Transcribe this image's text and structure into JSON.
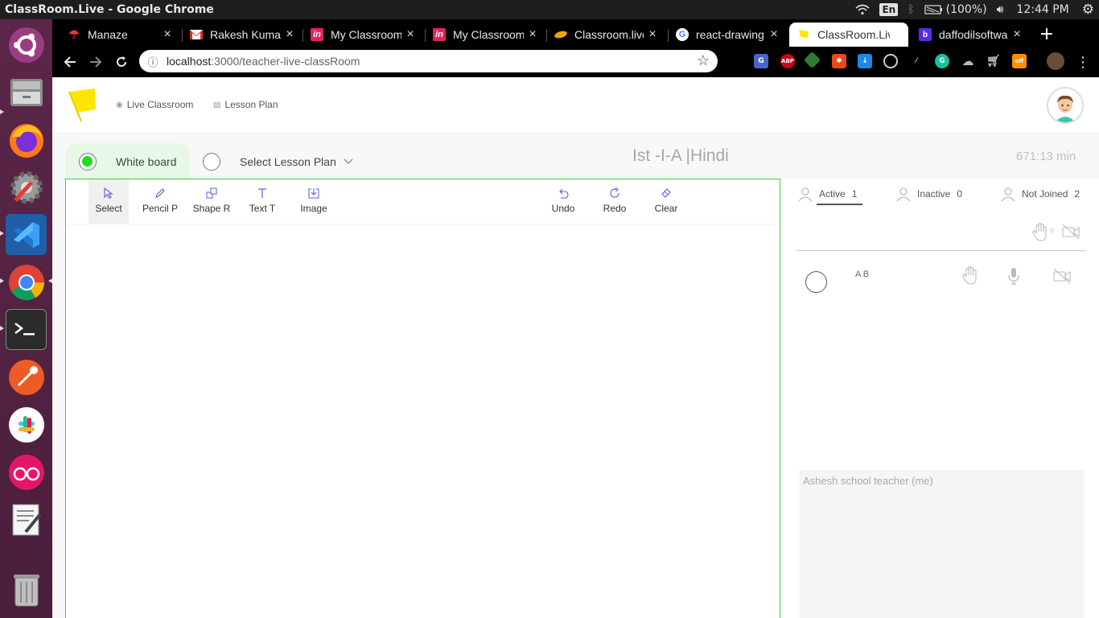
{
  "window": {
    "title": "ClassRoom.Live - Google Chrome"
  },
  "tray": {
    "lang": "En",
    "battery": "(100%)",
    "time": "12:44 PM"
  },
  "dock": {
    "items": [
      "ubuntu-icon",
      "files-icon",
      "firefox-icon",
      "settings-icon",
      "vscode-icon",
      "chrome-icon",
      "terminal-icon",
      "postman-icon",
      "slack-icon",
      "flickr-icon",
      "text-editor-icon",
      "trash-icon"
    ]
  },
  "tabs": [
    {
      "label": "Manaze",
      "color": "#e53935"
    },
    {
      "label": "Rakesh Kumar",
      "color": "#d93025"
    },
    {
      "label": "My Classroom",
      "color": "#e0245e"
    },
    {
      "label": "My Classroom",
      "color": "#e0245e"
    },
    {
      "label": "Classroom.live",
      "color": "#f0a300"
    },
    {
      "label": "react-drawing",
      "color": "#4285f4"
    },
    {
      "label": "ClassRoom.Live",
      "color": "#ffe600"
    },
    {
      "label": "daffodilsoftware",
      "color": "#5b2be0"
    }
  ],
  "omnibox": {
    "host": "localhost",
    "path": ":3000/teacher-live-classRoom"
  },
  "nav": {
    "live_classroom": "Live Classroom",
    "lesson_plan": "Lesson Plan"
  },
  "controls": {
    "white_board": "White board",
    "select_lesson_plan": "Select Lesson Plan"
  },
  "class": {
    "title": "Ist -I-A |Hindi",
    "timer": "671:13 min"
  },
  "toolbar": {
    "select": "Select",
    "pencil": "Pencil P",
    "shape": "Shape R",
    "text": "Text T",
    "image": "Image",
    "undo": "Undo",
    "redo": "Redo",
    "clear": "Clear"
  },
  "participants": {
    "active_label": "Active",
    "active_count": "1",
    "inactive_label": "Inactive",
    "inactive_count": "0",
    "not_joined_label": "Not Joined",
    "not_joined_count": "2",
    "hand_count": "0",
    "student_name": "A B"
  },
  "chat": {
    "self_name": "Ashesh school teacher (me)"
  },
  "colors": {
    "accent_green": "#22dd22",
    "board_border": "#3bd03b",
    "tool_icon": "#5a5cd6",
    "brand_flag": "#ffe600"
  }
}
